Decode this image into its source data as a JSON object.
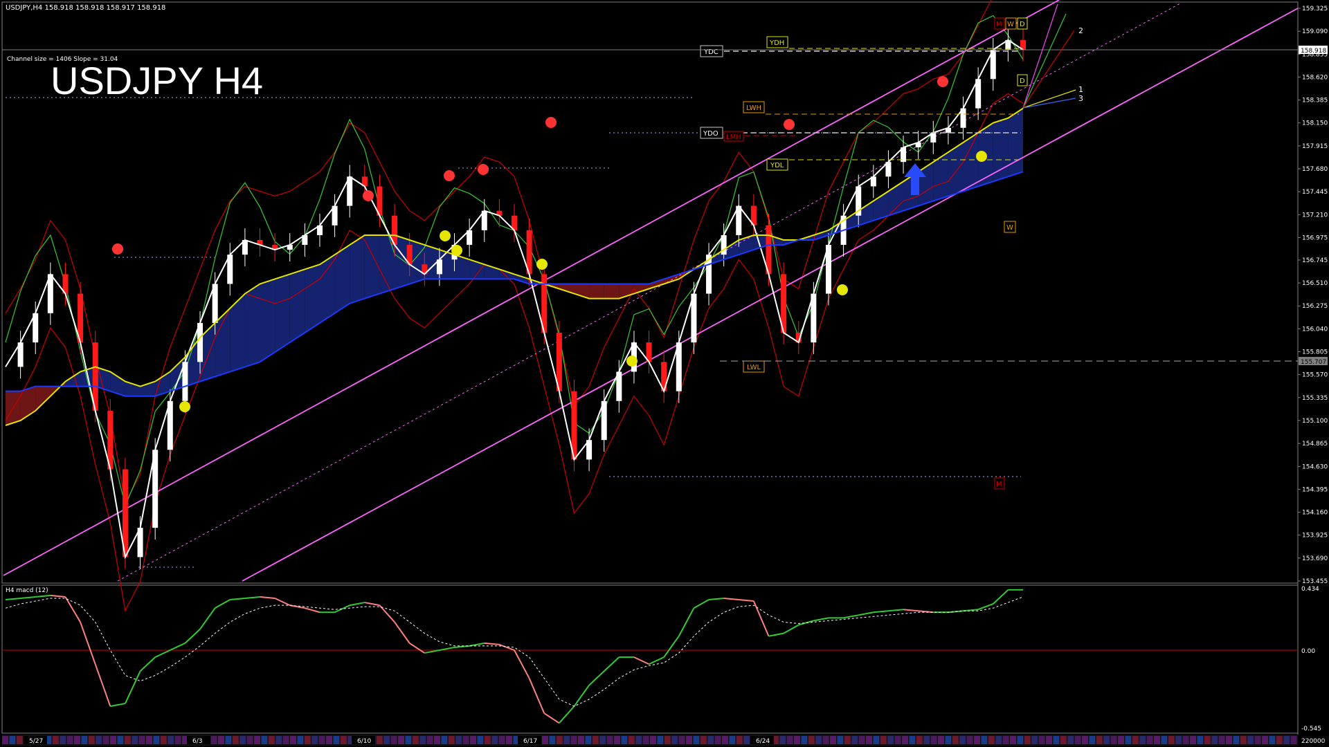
{
  "header": {
    "symbol_line": "USDJPY,H4  158.918 158.918 158.917 158.918",
    "channel_info": "Channel size = 1406 Slope = 31.04",
    "big_title": "USDJPY H4"
  },
  "colors": {
    "background": "#000000",
    "bull_candle": "#ffffff",
    "bear_candle": "#ff1a1a",
    "channel": "#ff66ff",
    "ma_white": "#ffffff",
    "ma_yellow": "#e6e600",
    "ma_blue": "#1a3aff",
    "bollinger": "#cc0000",
    "green_line": "#33cc33",
    "cloud_bull": "#1a2a8a",
    "cloud_bear": "#8a1a1a",
    "macd_up": "#33cc33",
    "macd_down": "#ff8080",
    "marker": "#ff3333",
    "arrow": "#2a4aff"
  },
  "price_axis": {
    "ticks": [
      "159.325",
      "159.090",
      "158.855",
      "158.620",
      "158.385",
      "158.150",
      "157.915",
      "157.680",
      "157.445",
      "157.210",
      "156.975",
      "156.745",
      "156.510",
      "156.275",
      "156.040",
      "155.805",
      "155.570",
      "155.335",
      "155.100",
      "154.865",
      "154.630",
      "154.395",
      "154.160",
      "153.925",
      "153.690",
      "153.455"
    ],
    "current_price": "158.918",
    "level_tag": "155.707"
  },
  "level_labels": {
    "ydc": "YDC",
    "ydh": "YDH",
    "ydo": "YDO",
    "ydl": "YDL",
    "lwh": "LWH",
    "lmh": "LMH",
    "lwl": "LWL",
    "w": "W",
    "d_top": "D",
    "d_mid": "D",
    "m_top": "M",
    "w_top": "W",
    "m_bottom": "M"
  },
  "fan_labels": [
    "2",
    "1",
    "3"
  ],
  "macd": {
    "title": "H4  macd (12)",
    "ticks": [
      "0.434",
      "0.00",
      "-0.545"
    ]
  },
  "time_axis": {
    "labels": [
      "5/27",
      "6/3",
      "6/10",
      "6/17",
      "6/24"
    ],
    "right_label": "220000"
  },
  "chart_data": {
    "type": "line",
    "title": "USDJPY H4",
    "symbol": "USDJPY",
    "timeframe": "H4",
    "ylim": [
      153.455,
      159.325
    ],
    "x": [
      "5/27",
      "6/3",
      "6/10",
      "6/17",
      "6/24"
    ],
    "last_price": 158.918,
    "series": [
      {
        "values": [
          155.65,
          155.9,
          156.2,
          156.6,
          156.4,
          155.9,
          155.2,
          154.6,
          153.7,
          154.0,
          154.8,
          155.3,
          155.7,
          156.1,
          156.5,
          156.8,
          156.95,
          156.9,
          156.85,
          156.9,
          157.0,
          157.1,
          157.3,
          157.6,
          157.5,
          157.2,
          156.9,
          156.7,
          156.6,
          156.75,
          156.9,
          157.05,
          157.25,
          157.2,
          157.05,
          156.6,
          156.0,
          155.4,
          154.7,
          154.9,
          155.3,
          155.6,
          155.9,
          155.7,
          155.4,
          155.9,
          156.4,
          156.8,
          157.0,
          157.3,
          157.1,
          156.6,
          156.0,
          155.9,
          156.4,
          156.9,
          157.2,
          157.5,
          157.6,
          157.75,
          157.9,
          157.95,
          158.05,
          158.1,
          158.3,
          158.6,
          158.9,
          159.0,
          158.9
        ],
        "note_colors": "ma_white"
      },
      {
        "values": [
          155.05,
          155.1,
          155.2,
          155.35,
          155.5,
          155.6,
          155.65,
          155.6,
          155.5,
          155.45,
          155.5,
          155.6,
          155.75,
          155.95,
          156.1,
          156.25,
          156.4,
          156.5,
          156.55,
          156.6,
          156.65,
          156.7,
          156.8,
          156.9,
          157.0,
          157.0,
          157.0,
          156.95,
          156.9,
          156.85,
          156.8,
          156.75,
          156.7,
          156.65,
          156.6,
          156.55,
          156.5,
          156.45,
          156.4,
          156.35,
          156.35,
          156.35,
          156.4,
          156.45,
          156.5,
          156.55,
          156.65,
          156.75,
          156.85,
          156.95,
          157.0,
          157.0,
          156.95,
          156.95,
          157.0,
          157.05,
          157.15,
          157.25,
          157.35,
          157.45,
          157.55,
          157.65,
          157.75,
          157.85,
          157.95,
          158.05,
          158.15,
          158.2,
          158.3
        ],
        "note_colors": "ma_yellow"
      },
      {
        "values": [
          155.4,
          155.4,
          155.45,
          155.45,
          155.45,
          155.45,
          155.45,
          155.4,
          155.35,
          155.35,
          155.35,
          155.4,
          155.45,
          155.5,
          155.55,
          155.6,
          155.65,
          155.7,
          155.8,
          155.9,
          156.0,
          156.1,
          156.2,
          156.3,
          156.35,
          156.4,
          156.45,
          156.5,
          156.55,
          156.55,
          156.55,
          156.55,
          156.55,
          156.55,
          156.55,
          156.5,
          156.5,
          156.5,
          156.5,
          156.5,
          156.5,
          156.5,
          156.5,
          156.5,
          156.55,
          156.6,
          156.65,
          156.7,
          156.75,
          156.8,
          156.85,
          156.9,
          156.9,
          156.95,
          156.95,
          157.0,
          157.05,
          157.1,
          157.15,
          157.2,
          157.25,
          157.3,
          157.35,
          157.4,
          157.45,
          157.5,
          157.55,
          157.6,
          157.65
        ],
        "note_colors": "ma_blue"
      }
    ],
    "macd_ylim": [
      -0.545,
      0.434
    ],
    "macd_values": [
      0.36,
      0.37,
      0.38,
      0.39,
      0.38,
      0.2,
      -0.1,
      -0.4,
      -0.38,
      -0.15,
      -0.05,
      0.0,
      0.05,
      0.15,
      0.3,
      0.36,
      0.37,
      0.38,
      0.37,
      0.32,
      0.3,
      0.27,
      0.27,
      0.32,
      0.34,
      0.32,
      0.2,
      0.05,
      -0.02,
      0.0,
      0.02,
      0.03,
      0.05,
      0.04,
      0.0,
      -0.2,
      -0.45,
      -0.52,
      -0.4,
      -0.25,
      -0.15,
      -0.05,
      -0.05,
      -0.1,
      -0.05,
      0.1,
      0.3,
      0.36,
      0.37,
      0.36,
      0.35,
      0.1,
      0.12,
      0.18,
      0.21,
      0.23,
      0.23,
      0.25,
      0.27,
      0.28,
      0.29,
      0.28,
      0.27,
      0.27,
      0.28,
      0.29,
      0.33,
      0.43,
      0.43
    ],
    "macd_signal": [
      0.3,
      0.33,
      0.35,
      0.37,
      0.37,
      0.32,
      0.2,
      0.0,
      -0.18,
      -0.22,
      -0.18,
      -0.12,
      -0.05,
      0.03,
      0.12,
      0.2,
      0.26,
      0.3,
      0.32,
      0.32,
      0.31,
      0.3,
      0.29,
      0.3,
      0.31,
      0.31,
      0.28,
      0.2,
      0.12,
      0.06,
      0.03,
      0.03,
      0.03,
      0.03,
      0.02,
      -0.05,
      -0.2,
      -0.35,
      -0.4,
      -0.35,
      -0.28,
      -0.2,
      -0.14,
      -0.11,
      -0.09,
      -0.02,
      0.1,
      0.2,
      0.27,
      0.31,
      0.32,
      0.25,
      0.2,
      0.19,
      0.2,
      0.21,
      0.22,
      0.23,
      0.24,
      0.25,
      0.26,
      0.27,
      0.27,
      0.27,
      0.28,
      0.28,
      0.3,
      0.34,
      0.38
    ]
  }
}
